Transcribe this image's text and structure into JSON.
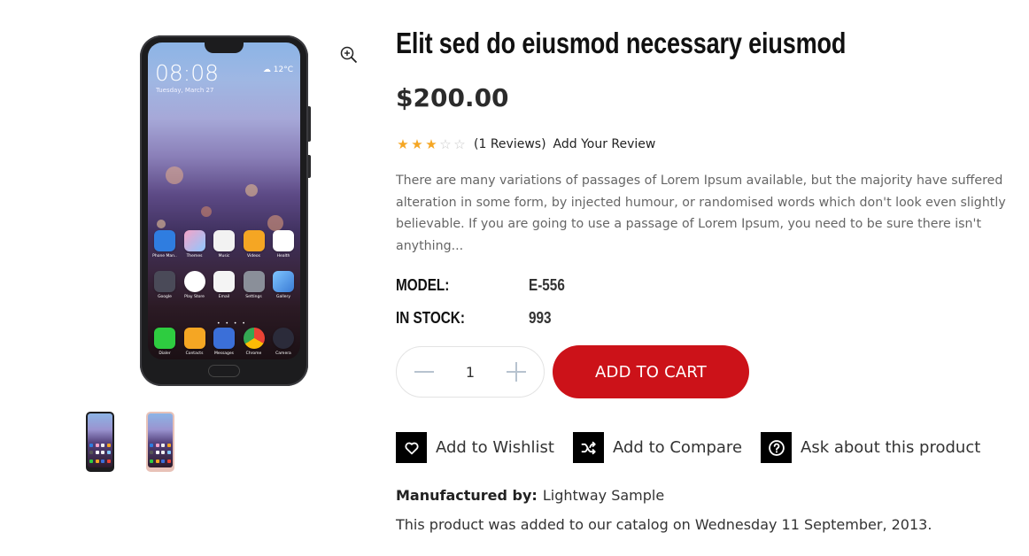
{
  "product": {
    "title": "Elit sed do eiusmod necessary eiusmod",
    "price": "$200.00",
    "rating": {
      "value": 3,
      "max": 5,
      "reviews_text": "(1  Reviews)",
      "add_review_label": "Add Your Review"
    },
    "description": "There are many variations of passages of Lorem Ipsum available, but the majority have suffered alteration in some form, by injected humour, or randomised words which don't look even slightly believable. If you are going to use a passage of Lorem Ipsum, you need to be sure there isn't anything...",
    "specs": [
      {
        "label": "MODEL:",
        "value": "E-556"
      },
      {
        "label": "IN STOCK:",
        "value": "993"
      }
    ],
    "quantity": "1",
    "add_to_cart_label": "ADD TO CART",
    "actions": [
      {
        "label": "Add to Wishlist",
        "icon": "heart-icon"
      },
      {
        "label": "Add to Compare",
        "icon": "shuffle-icon"
      },
      {
        "label": "Ask about this product",
        "icon": "question-icon"
      }
    ],
    "manufacturer_label": "Manufactured by:",
    "manufacturer": "Lightway Sample",
    "added_text": "This product was added to our catalog on Wednesday 11 September, 2013."
  },
  "gallery": {
    "phone_screen": {
      "time": "08:08",
      "date": "Tuesday, March 27",
      "weather_temp": "12°C",
      "apps_row1": [
        "Phone Man..",
        "Themes",
        "Music",
        "Videos",
        "Health"
      ],
      "apps_row2": [
        "Google",
        "Play Store",
        "Email",
        "Settings",
        "Gallery"
      ],
      "dock": [
        "Dialer",
        "Contacts",
        "Messages",
        "Chrome",
        "Camera"
      ]
    },
    "thumbnails": [
      {
        "name": "black-phone",
        "color": "#1c1c1e"
      },
      {
        "name": "pink-phone",
        "color": "#e8c2b8"
      }
    ]
  },
  "colors": {
    "accent": "#cc1219",
    "star": "#f5a623",
    "icon_box": "#000000"
  }
}
